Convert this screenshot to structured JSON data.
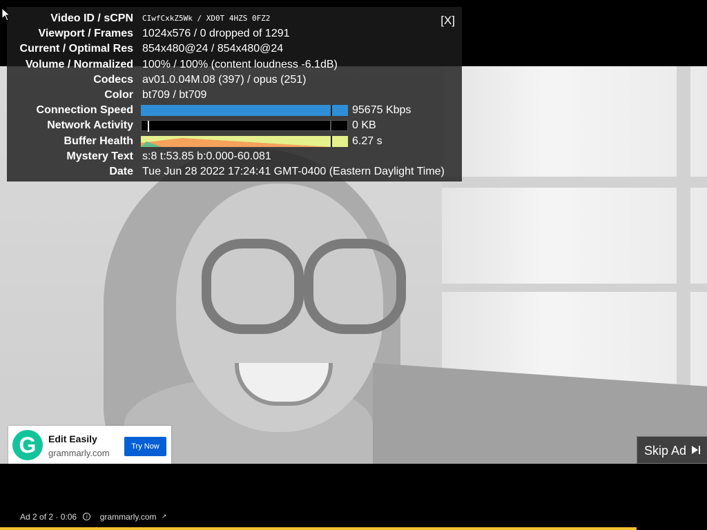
{
  "stats": {
    "close_label": "[X]",
    "rows": [
      {
        "key": "Video ID / sCPN",
        "value": "CIwfCxkZ5Wk / XD0T 4HZS 0FZ2"
      },
      {
        "key": "Viewport / Frames",
        "value": "1024x576 / 0 dropped of 1291"
      },
      {
        "key": "Current / Optimal Res",
        "value": "854x480@24 / 854x480@24"
      },
      {
        "key": "Volume / Normalized",
        "value": "100% / 100% (content loudness -6.1dB)"
      },
      {
        "key": "Codecs",
        "value": "av01.0.04M.08 (397) / opus (251)"
      },
      {
        "key": "Color",
        "value": "bt709 / bt709"
      },
      {
        "key": "Connection Speed",
        "value": "95675 Kbps"
      },
      {
        "key": "Network Activity",
        "value": "0 KB"
      },
      {
        "key": "Buffer Health",
        "value": "6.27 s"
      },
      {
        "key": "Mystery Text",
        "value": "s:8 t:53.85 b:0.000-60.081"
      },
      {
        "key": "Date",
        "value": "Tue Jun 28 2022 17:24:41 GMT-0400 (Eastern Daylight Time)"
      }
    ]
  },
  "ad_card": {
    "logo_letter": "G",
    "title": "Edit Easily",
    "domain": "grammarly.com",
    "cta": "Try Now",
    "logo_color": "#15c39a",
    "cta_color": "#065fd4"
  },
  "skip": {
    "label": "Skip Ad",
    "icon": "skip-next-icon"
  },
  "ad_info": {
    "position": "Ad 2 of 2 · 0:06",
    "info_icon": "info-icon",
    "domain": "grammarly.com",
    "link_icon": "external-link-icon"
  },
  "colors": {
    "progress": "#f2c12e",
    "connection_bar": "#2f8ed6"
  }
}
